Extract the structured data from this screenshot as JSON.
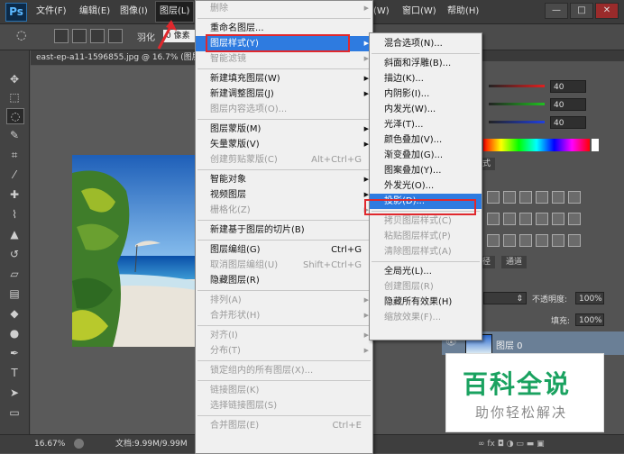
{
  "app": {
    "logo": "Ps"
  },
  "menubar": {
    "items": [
      "文件(F)",
      "编辑(E)",
      "图像(I)",
      "图层(L)",
      "(W)",
      "窗口(W)",
      "帮助(H)"
    ]
  },
  "window_buttons": [
    "—",
    "□",
    "✕"
  ],
  "options": {
    "feather_label": "羽化",
    "feather_value": "0 像素"
  },
  "document": {
    "tab_title": "east-ep-a11-1596855.jpg @ 16.7% (图层 0, RGB/8)",
    "zoom": "16.67%",
    "doc_size": "文档:9.99M/9.99M"
  },
  "color_panel": {
    "values": [
      "40",
      "40",
      "40"
    ]
  },
  "styles_tab": "式",
  "layers_panel": {
    "tabs": [
      "径",
      "通道"
    ],
    "opacity_label": "不透明度:",
    "opacity_value": "100%",
    "fill_label": "填充:",
    "fill_value": "100%",
    "layer_name": "图层 0"
  },
  "layer_menu": {
    "items": [
      {
        "label": "删除",
        "disabled": true,
        "arrow": true
      },
      {
        "sep": true
      },
      {
        "label": "重命名图层..."
      },
      {
        "label": "图层样式(Y)",
        "arrow": true,
        "highlight": true
      },
      {
        "label": "智能滤镜",
        "disabled": true,
        "arrow": true
      },
      {
        "sep": true
      },
      {
        "label": "新建填充图层(W)",
        "arrow": true
      },
      {
        "label": "新建调整图层(J)",
        "arrow": true
      },
      {
        "label": "图层内容选项(O)...",
        "disabled": true
      },
      {
        "sep": true
      },
      {
        "label": "图层蒙版(M)",
        "arrow": true
      },
      {
        "label": "矢量蒙版(V)",
        "arrow": true
      },
      {
        "label": "创建剪贴蒙版(C)",
        "disabled": true,
        "shortcut": "Alt+Ctrl+G"
      },
      {
        "sep": true
      },
      {
        "label": "智能对象",
        "arrow": true
      },
      {
        "label": "视频图层",
        "arrow": true
      },
      {
        "label": "栅格化(Z)",
        "disabled": true,
        "arrow": true
      },
      {
        "sep": true
      },
      {
        "label": "新建基于图层的切片(B)"
      },
      {
        "sep": true
      },
      {
        "label": "图层编组(G)",
        "shortcut": "Ctrl+G"
      },
      {
        "label": "取消图层编组(U)",
        "disabled": true,
        "shortcut": "Shift+Ctrl+G"
      },
      {
        "label": "隐藏图层(R)"
      },
      {
        "sep": true
      },
      {
        "label": "排列(A)",
        "disabled": true,
        "arrow": true
      },
      {
        "label": "合并形状(H)",
        "disabled": true,
        "arrow": true
      },
      {
        "sep": true
      },
      {
        "label": "对齐(I)",
        "disabled": true,
        "arrow": true
      },
      {
        "label": "分布(T)",
        "disabled": true,
        "arrow": true
      },
      {
        "sep": true
      },
      {
        "label": "锁定组内的所有图层(X)...",
        "disabled": true
      },
      {
        "sep": true
      },
      {
        "label": "链接图层(K)",
        "disabled": true
      },
      {
        "label": "选择链接图层(S)",
        "disabled": true
      },
      {
        "sep": true
      },
      {
        "label": "合并图层(E)",
        "disabled": true,
        "shortcut": "Ctrl+E"
      }
    ]
  },
  "style_submenu": {
    "items": [
      {
        "label": "混合选项(N)..."
      },
      {
        "sep": true
      },
      {
        "label": "斜面和浮雕(B)..."
      },
      {
        "label": "描边(K)..."
      },
      {
        "label": "内阴影(I)..."
      },
      {
        "label": "内发光(W)..."
      },
      {
        "label": "光泽(T)..."
      },
      {
        "label": "颜色叠加(V)..."
      },
      {
        "label": "渐变叠加(G)..."
      },
      {
        "label": "图案叠加(Y)..."
      },
      {
        "label": "外发光(O)..."
      },
      {
        "label": "投影(D)...",
        "highlight": true
      },
      {
        "sep": true
      },
      {
        "label": "拷贝图层样式(C)",
        "disabled": true
      },
      {
        "label": "粘贴图层样式(P)",
        "disabled": true
      },
      {
        "label": "清除图层样式(A)",
        "disabled": true
      },
      {
        "sep": true
      },
      {
        "label": "全局光(L)..."
      },
      {
        "label": "创建图层(R)",
        "disabled": true
      },
      {
        "label": "隐藏所有效果(H)"
      },
      {
        "label": "缩放效果(F)...",
        "disabled": true
      }
    ]
  },
  "watermark": {
    "title": "百科全说",
    "subtitle": "助你轻松解决"
  },
  "colors": {
    "highlight": "#2e7be0",
    "annotation": "#e0282d",
    "watermark_green": "#1aa260"
  }
}
